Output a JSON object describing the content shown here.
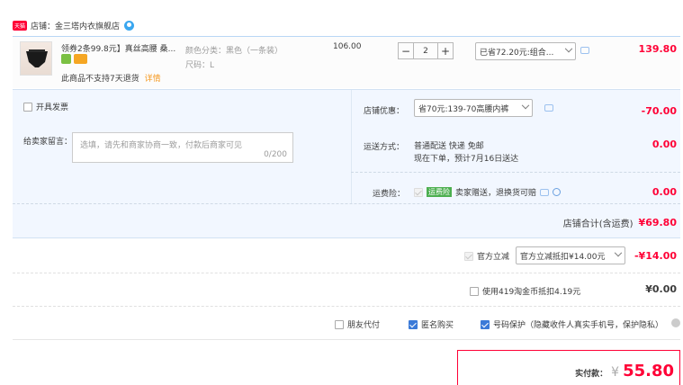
{
  "shop": {
    "badge": "天猫",
    "label": "店铺：",
    "name": "金三塔内衣旗舰店"
  },
  "item": {
    "title": "领券2条99.8元】真丝高腰 桑...",
    "notice": "此商品不支持7天退货",
    "notice_link": "详情",
    "color_label": "颜色分类：",
    "color_value": "黑色（一条装）",
    "size_label": "尺码：",
    "size_value": "L",
    "unit_price": "106.00",
    "quantity": "2",
    "minus": "−",
    "plus": "+",
    "promo_select": "已省72.20元:组合...",
    "subtotal": "139.80"
  },
  "invoice": {
    "label": "开具发票"
  },
  "shop_promo": {
    "label": "店铺优惠：",
    "select": "省70元:139-70高腰内裤",
    "amount": "-70.00"
  },
  "message": {
    "label": "给卖家留言：",
    "placeholder": "选填，请先和商家协商一致，付款后商家可见",
    "counter": "0/200"
  },
  "shipping": {
    "label": "运送方式：",
    "method": "普通配送 快递 免邮",
    "eta": "现在下单，预计7月16日送达",
    "amount": "0.00"
  },
  "insurance": {
    "label": "运费险：",
    "tag": "运费险",
    "desc": "卖家赠送，退换货可赔",
    "amount": "0.00"
  },
  "shop_total": {
    "label": "店铺合计(含运费)",
    "amount": "¥69.80"
  },
  "official": {
    "label": "官方立减",
    "select": "官方立减抵扣¥14.00元",
    "amount": "-¥14.00"
  },
  "coins": {
    "label": "使用419淘金币抵扣4.19元",
    "amount": "¥0.00"
  },
  "options": {
    "friend_pay": "朋友代付",
    "anonymous": "匿名购买",
    "privacy": "号码保护（隐藏收件人真实手机号，保护隐私）"
  },
  "payment": {
    "label": "实付款：",
    "currency": "¥",
    "amount": "55.80"
  }
}
